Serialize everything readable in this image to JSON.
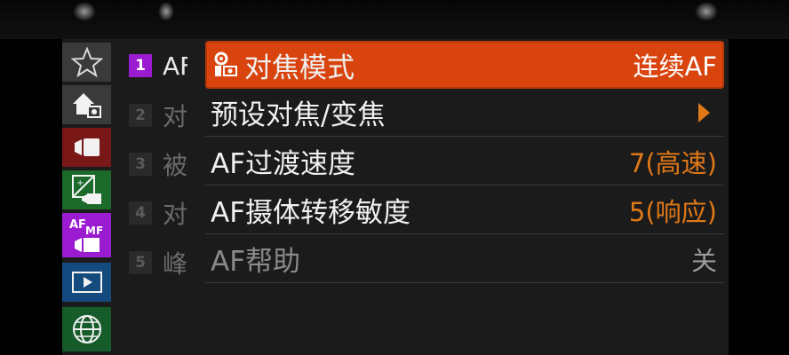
{
  "side_tabs": [
    {
      "icon": "star-icon",
      "bg": "#3a3a3a",
      "active": false
    },
    {
      "icon": "camera-home-icon",
      "bg": "#3a3a3a",
      "active": false
    },
    {
      "icon": "movie-camera-icon",
      "bg": "#7a1818",
      "active": false
    },
    {
      "icon": "exposure-compensation-icon",
      "bg": "#1c6a2a",
      "active": false
    },
    {
      "icon": "af-mf-icon",
      "bg": "#9b1bd1",
      "active": true,
      "label_top": "AF",
      "label_sub": "MF"
    },
    {
      "icon": "playback-icon",
      "bg": "#154a7e",
      "active": false
    },
    {
      "icon": "globe-network-icon",
      "bg": "#155c2a",
      "active": false
    }
  ],
  "pages": [
    {
      "num": "1",
      "title": "AF",
      "active": true
    },
    {
      "num": "2",
      "title": "对",
      "active": false
    },
    {
      "num": "3",
      "title": "被",
      "active": false
    },
    {
      "num": "4",
      "title": "对",
      "active": false
    },
    {
      "num": "5",
      "title": "峰",
      "active": false
    }
  ],
  "menu": [
    {
      "label": "对焦模式",
      "value": "连续AF",
      "selected": true,
      "has_icon": true
    },
    {
      "label": "预设对焦/变焦",
      "value": "",
      "submenu_arrow": true
    },
    {
      "label": "AF过渡速度",
      "value": "7(高速)"
    },
    {
      "label": "AF摄体转移敏度",
      "value": "5(响应)"
    },
    {
      "label": "AF帮助",
      "value": "关",
      "dim": true
    }
  ],
  "colors": {
    "accent_selected": "#d9440e",
    "value_orange": "#e07818",
    "page_active": "#9b1bd1"
  }
}
